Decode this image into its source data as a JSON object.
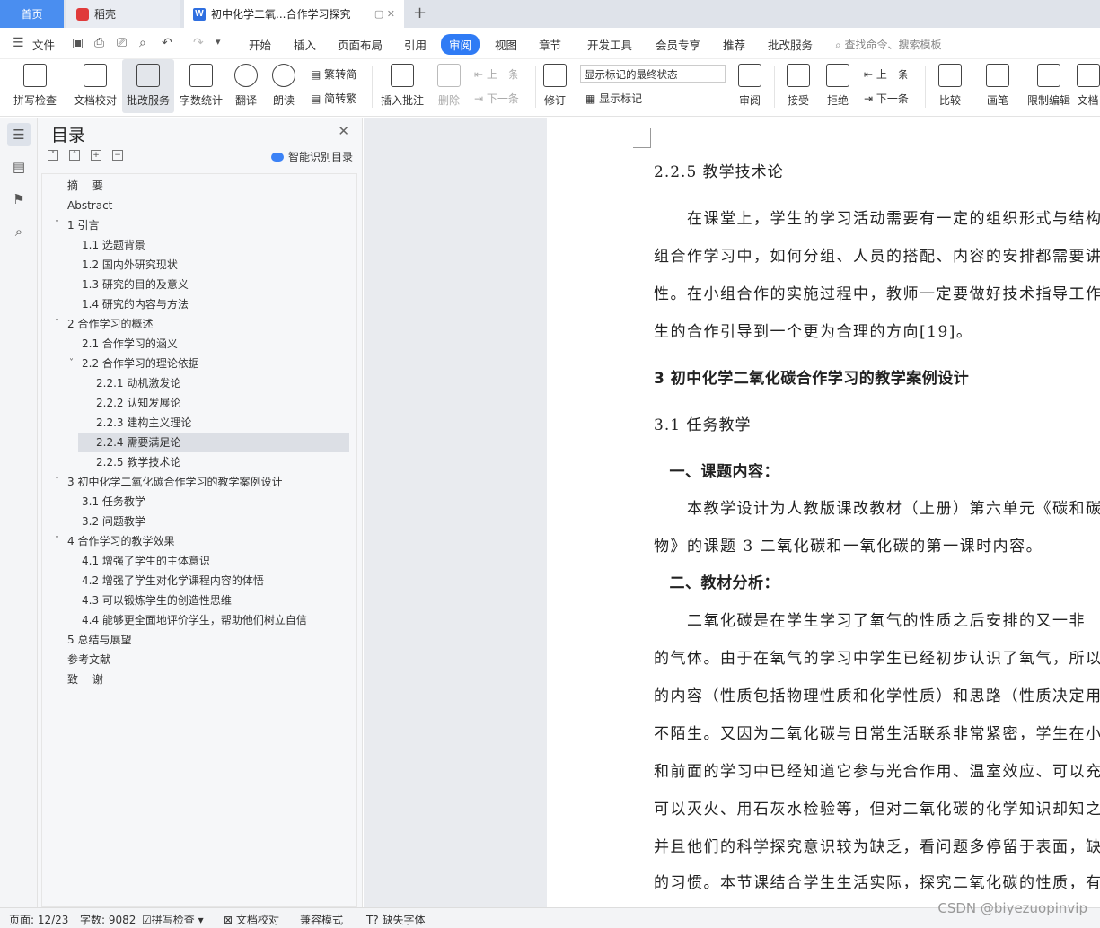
{
  "tabs": {
    "home": "首页",
    "daoke": "稻壳",
    "doc": "初中化学二氧...合作学习探究"
  },
  "menu": {
    "file": "文件",
    "items": [
      "开始",
      "插入",
      "页面布局",
      "引用",
      "审阅",
      "视图",
      "章节",
      "开发工具",
      "会员专享",
      "推荐",
      "批改服务"
    ],
    "active": "审阅",
    "search": "查找命令、搜索模板"
  },
  "ribbon": {
    "spell": "拼写检查",
    "doccheck": "文档校对",
    "correct": "批改服务",
    "wordcount": "字数统计",
    "translate": "翻译",
    "read": "朗读",
    "fan2jian": "繁转简",
    "jian2fan": "简转繁",
    "insert_comment": "插入批注",
    "delete": "删除",
    "prev": "上一条",
    "next": "下一条",
    "revise": "修订",
    "markup_state": "显示标记的最终状态",
    "show_markup": "显示标记",
    "review": "审阅",
    "accept": "接受",
    "reject": "拒绝",
    "prev2": "上一条",
    "next2": "下一条",
    "compare": "比较",
    "pen": "画笔",
    "restrict": "限制编辑",
    "doc_more": "文档"
  },
  "toc": {
    "title": "目录",
    "smart": "智能识别目录",
    "items": [
      {
        "text": "摘　 要"
      },
      {
        "text": "Abstract"
      },
      {
        "text": "1  引言"
      },
      {
        "text": "1.1  选题背景"
      },
      {
        "text": "1.2  国内外研究现状"
      },
      {
        "text": "1.3  研究的目的及意义"
      },
      {
        "text": "1.4  研究的内容与方法"
      },
      {
        "text": "2  合作学习的概述"
      },
      {
        "text": "2.1  合作学习的涵义"
      },
      {
        "text": "2.2  合作学习的理论依据"
      },
      {
        "text": "2.2.1 动机激发论"
      },
      {
        "text": "2.2.2 认知发展论"
      },
      {
        "text": "2.2.3 建构主义理论"
      },
      {
        "text": "2.2.4 需要满足论"
      },
      {
        "text": "2.2.5 教学技术论"
      },
      {
        "text": "3  初中化学二氧化碳合作学习的教学案例设计"
      },
      {
        "text": "3.1  任务教学"
      },
      {
        "text": "3.2  问题教学"
      },
      {
        "text": "4  合作学习的教学效果"
      },
      {
        "text": "4.1 增强了学生的主体意识"
      },
      {
        "text": "4.2 增强了学生对化学课程内容的体悟"
      },
      {
        "text": "4.3 可以锻炼学生的创造性思维"
      },
      {
        "text": "4.4 能够更全面地评价学生，帮助他们树立自信"
      },
      {
        "text": "5  总结与展望"
      },
      {
        "text": "参考文献"
      },
      {
        "text": "致　 谢"
      }
    ]
  },
  "doc": {
    "lines": [
      "2.2.5 教学技术论",
      "　　在课堂上，学生的学习活动需要有一定的组织形式与结构",
      "组合作学习中，如何分组、人员的搭配、内容的安排都需要讲",
      "性。在小组合作的实施过程中，教师一定要做好技术指导工作",
      "生的合作引导到一个更为合理的方向[19]。",
      "3  初中化学二氧化碳合作学习的教学案例设计",
      "3.1  任务教学",
      "　一、课题内容：",
      "　　本教学设计为人教版课改教材（上册）第六单元《碳和碳",
      "物》的课题 3 二氧化碳和一氧化碳的第一课时内容。",
      "　二、教材分析：",
      "　　二氧化碳是在学生学习了氧气的性质之后安排的又一非",
      "的气体。由于在氧气的学习中学生已经初步认识了氧气，所以",
      "的内容（性质包括物理性质和化学性质）和思路（性质决定用",
      "不陌生。又因为二氧化碳与日常生活联系非常紧密，学生在小",
      "和前面的学习中已经知道它参与光合作用、温室效应、可以充入",
      "可以灭火、用石灰水检验等，但对二氧化碳的化学知识却知之",
      "并且他们的科学探究意识较为缺乏，看问题多停留于表面，缺",
      "的习惯。本节课结合学生生活实际，探究二氧化碳的性质，有"
    ]
  },
  "status": {
    "page": "页面: 12/23",
    "words": "字数: 9082",
    "spell": "拼写检查",
    "doccheck": "文档校对",
    "compat": "兼容模式",
    "missing_font": "缺失字体"
  },
  "watermark": "CSDN @biyezuopinvip",
  "colors": {
    "accent": "#2f7bf5",
    "home_tab": "#4a8ef0"
  }
}
